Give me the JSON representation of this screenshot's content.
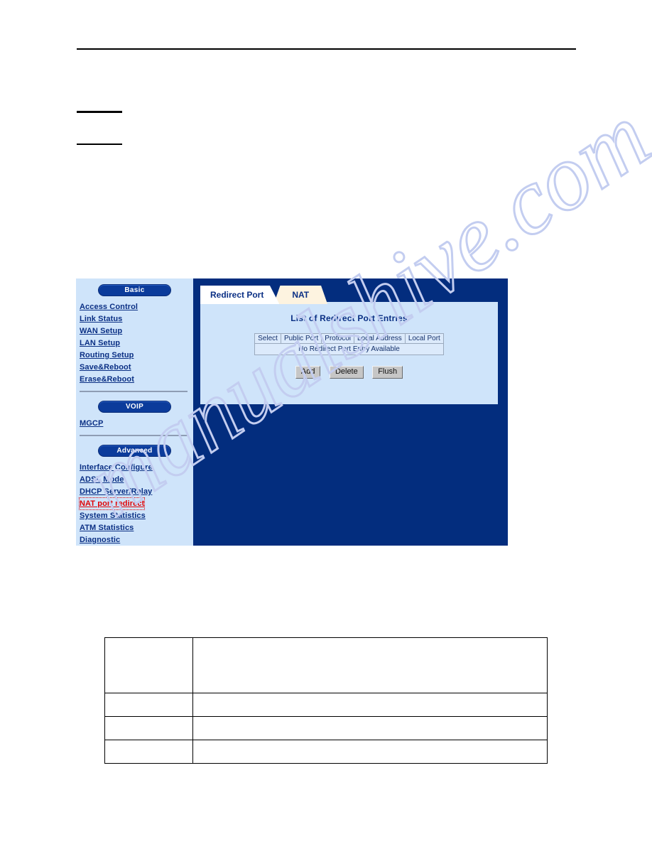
{
  "document": {
    "rules": [
      "top-rule",
      "short-rule-1",
      "short-rule-2"
    ],
    "watermark_text": "manualshive.com",
    "watermark_color": "#c3cdf0",
    "bottom_table": {
      "rows": [
        {
          "left": "",
          "right": "",
          "height": "tall"
        },
        {
          "left": "",
          "right": "",
          "height": "short"
        },
        {
          "left": "",
          "right": "",
          "height": "short"
        },
        {
          "left": "",
          "right": "",
          "height": "short"
        }
      ]
    }
  },
  "router_ui": {
    "background_color": "#032d7e",
    "sidebar": {
      "background_color": "#cfe4fa",
      "groups": [
        {
          "pill": "Basic",
          "items": [
            {
              "label": "Access Control",
              "active": false
            },
            {
              "label": "Link Status",
              "active": false
            },
            {
              "label": "WAN Setup",
              "active": false
            },
            {
              "label": "LAN Setup",
              "active": false
            },
            {
              "label": "Routing Setup",
              "active": false
            },
            {
              "label": "Save&Reboot",
              "active": false
            },
            {
              "label": "Erase&Reboot",
              "active": false
            }
          ]
        },
        {
          "pill": "VOIP",
          "items": [
            {
              "label": "MGCP",
              "active": false
            }
          ]
        },
        {
          "pill": "Advanced",
          "items": [
            {
              "label": "Interface Configure",
              "active": false
            },
            {
              "label": "ADSL Mode",
              "active": false
            },
            {
              "label": "DHCP Server/Relay",
              "active": false
            },
            {
              "label": "NAT port redirect",
              "active": true
            },
            {
              "label": "System Statistics",
              "active": false
            },
            {
              "label": "ATM Statistics",
              "active": false
            },
            {
              "label": "Diagnostic",
              "active": false
            }
          ]
        }
      ],
      "link_color": "#0a2f84",
      "active_link_color": "#e00000"
    },
    "tabs": [
      {
        "label": "Redirect Port",
        "active": true
      },
      {
        "label": "NAT",
        "active": false
      }
    ],
    "panel": {
      "title": "List of Redirect Port Entries",
      "title_color": "#0a2f84",
      "table": {
        "headers": [
          "Select",
          "Public Port",
          "Protocol",
          "Local Address",
          "Local Port"
        ],
        "empty_message": "No Redirect Port Entry Available",
        "rows": []
      },
      "buttons": [
        {
          "label": "Add"
        },
        {
          "label": "Delete"
        },
        {
          "label": "Flush"
        }
      ]
    }
  }
}
